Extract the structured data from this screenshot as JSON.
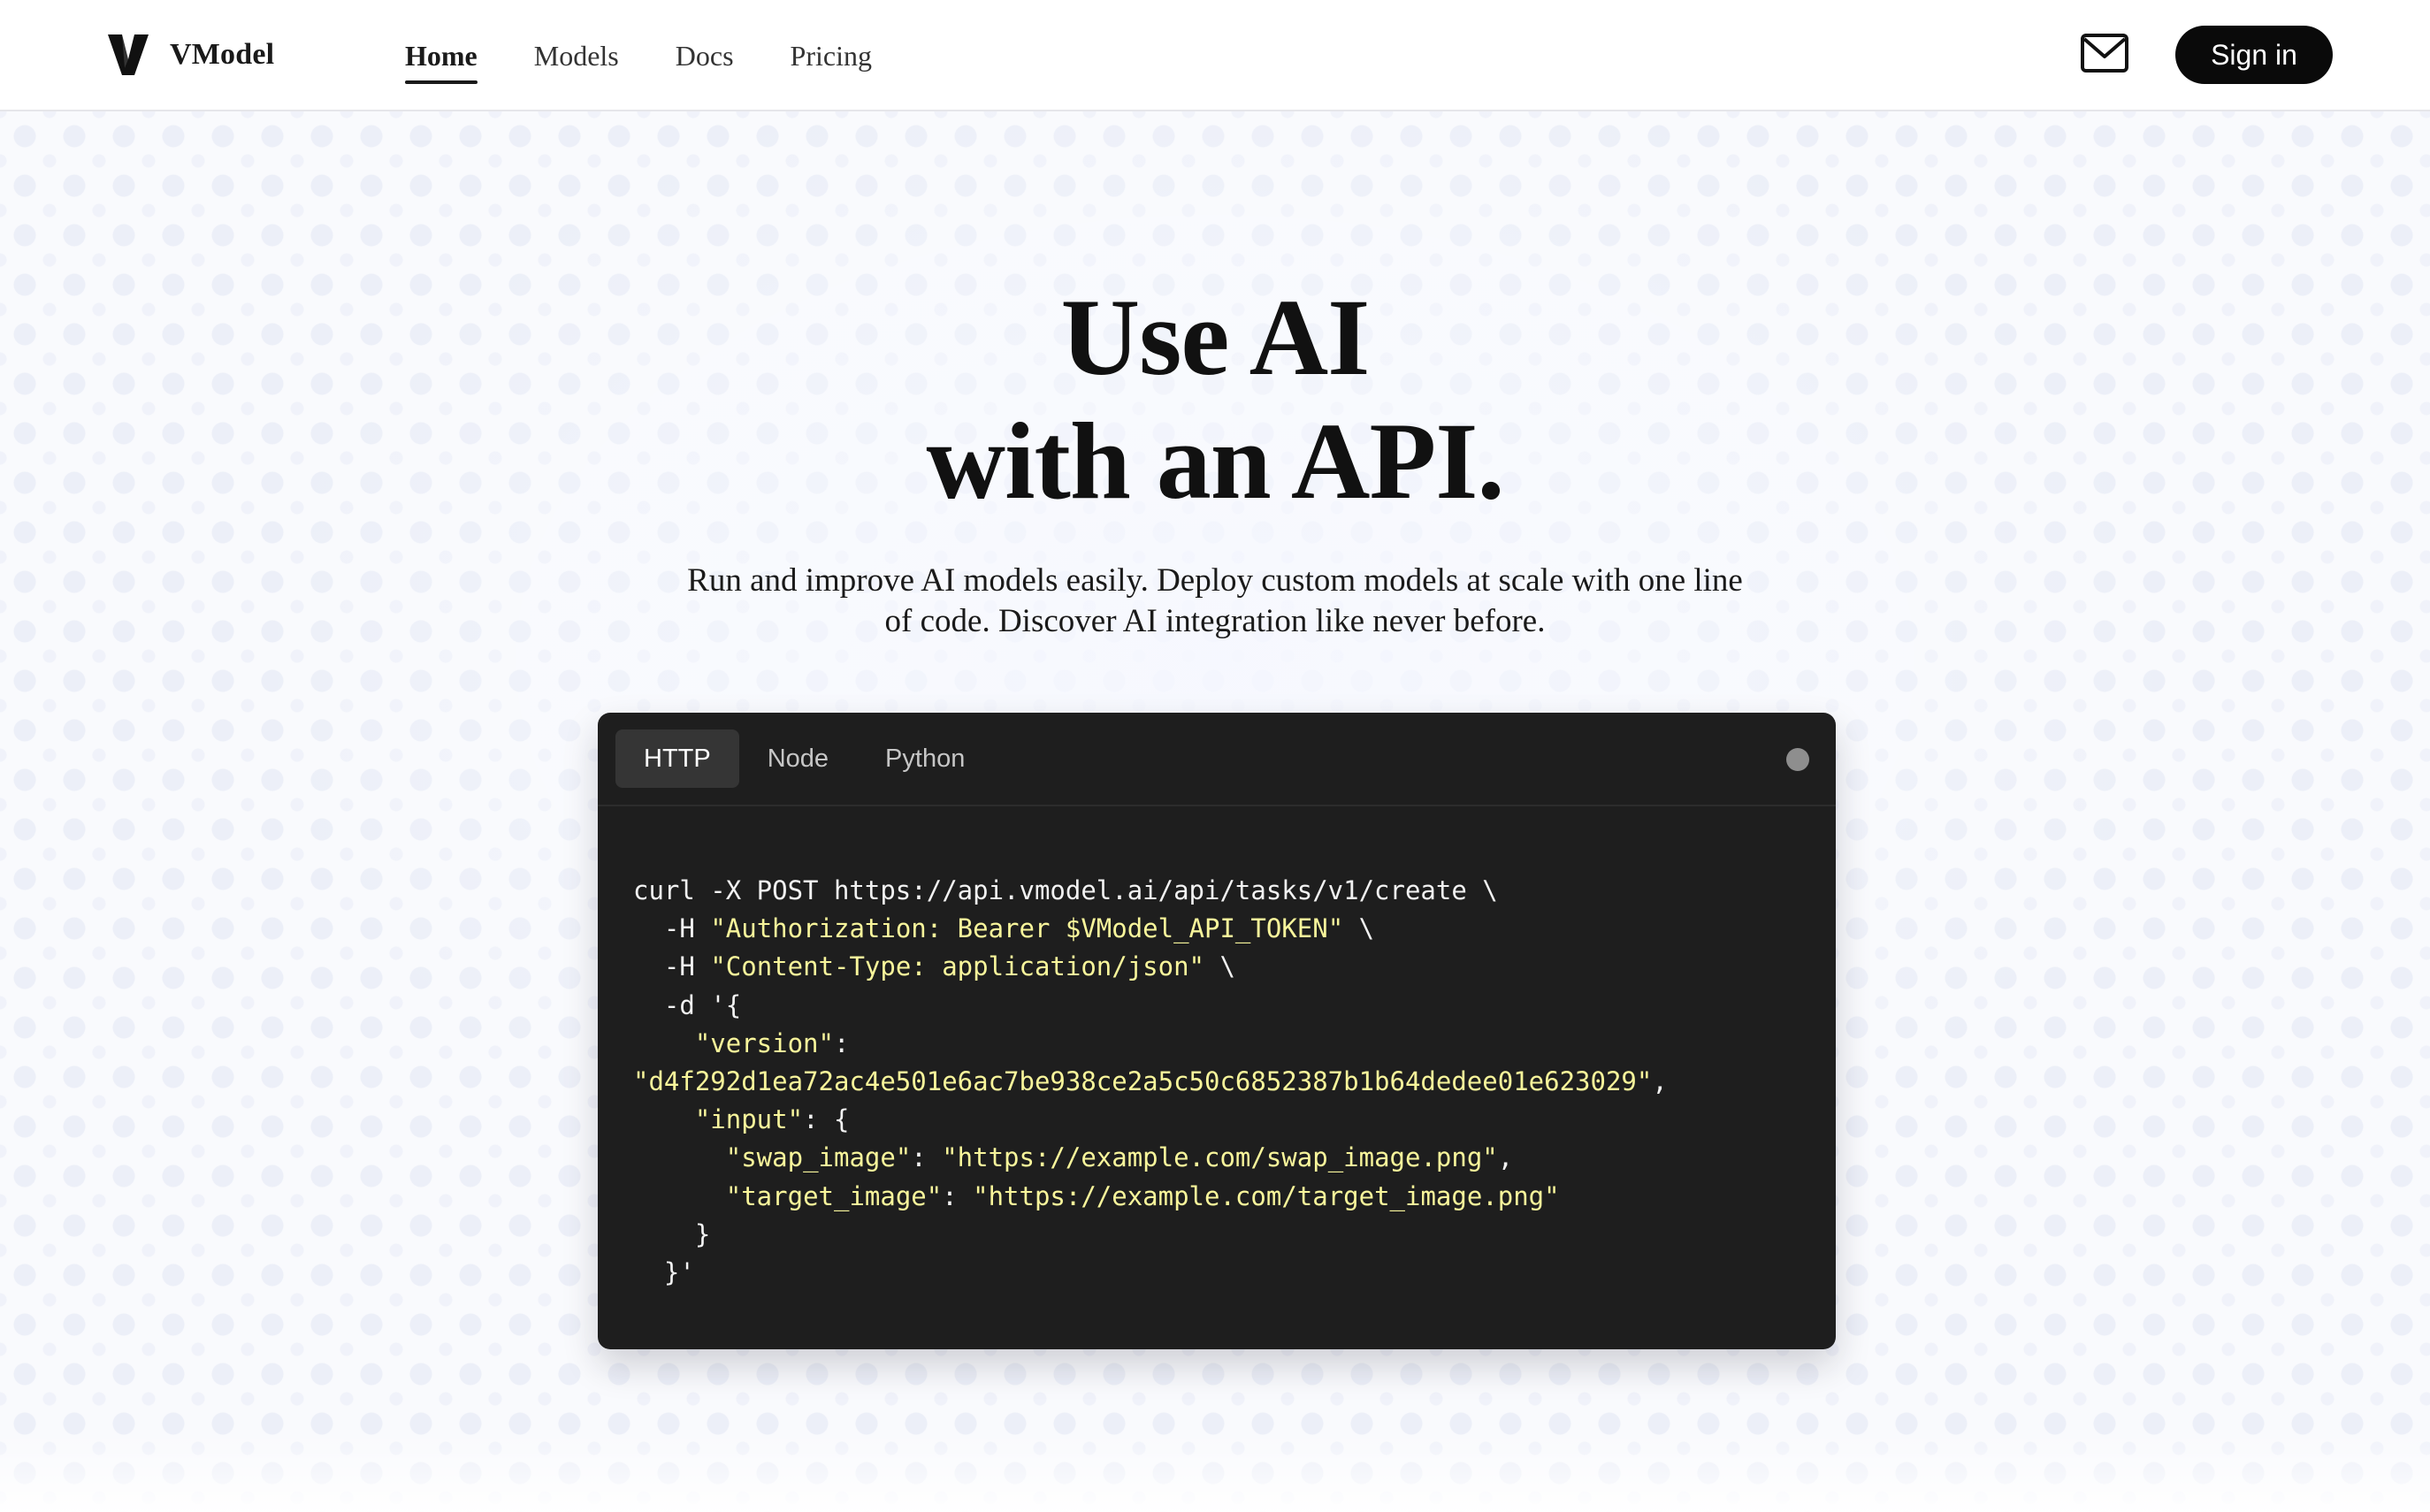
{
  "header": {
    "brand": "VModel",
    "nav": [
      {
        "label": "Home",
        "active": true
      },
      {
        "label": "Models",
        "active": false
      },
      {
        "label": "Docs",
        "active": false
      },
      {
        "label": "Pricing",
        "active": false
      }
    ],
    "mail_icon": "envelope-icon",
    "signin_label": "Sign in"
  },
  "hero": {
    "title_line1": "Use AI",
    "title_line2": "with an API.",
    "subtitle": "Run and improve AI models easily. Deploy custom models at scale with one line of code. Discover AI integration like never before."
  },
  "code": {
    "tabs": [
      {
        "label": "HTTP",
        "active": true
      },
      {
        "label": "Node",
        "active": false
      },
      {
        "label": "Python",
        "active": false
      }
    ],
    "lines": [
      [
        {
          "t": "curl -X POST https://api.vmodel.ai/api/tasks/v1/create \\",
          "c": "plain"
        }
      ],
      [
        {
          "t": "  -H ",
          "c": "plain"
        },
        {
          "t": "\"Authorization: Bearer $VModel_API_TOKEN\"",
          "c": "str"
        },
        {
          "t": " \\",
          "c": "plain"
        }
      ],
      [
        {
          "t": "  -H ",
          "c": "plain"
        },
        {
          "t": "\"Content-Type: application/json\"",
          "c": "str"
        },
        {
          "t": " \\",
          "c": "plain"
        }
      ],
      [
        {
          "t": "  -d '{",
          "c": "plain"
        }
      ],
      [
        {
          "t": "    ",
          "c": "plain"
        },
        {
          "t": "\"version\"",
          "c": "str"
        },
        {
          "t": ":",
          "c": "plain"
        }
      ],
      [
        {
          "t": "\"d4f292d1ea72ac4e501e6ac7be938ce2a5c50c6852387b1b64dedee01e623029\"",
          "c": "str"
        },
        {
          "t": ",",
          "c": "plain"
        }
      ],
      [
        {
          "t": "    ",
          "c": "plain"
        },
        {
          "t": "\"input\"",
          "c": "str"
        },
        {
          "t": ": {",
          "c": "plain"
        }
      ],
      [
        {
          "t": "      ",
          "c": "plain"
        },
        {
          "t": "\"swap_image\"",
          "c": "str"
        },
        {
          "t": ": ",
          "c": "plain"
        },
        {
          "t": "\"https://example.com/swap_image.png\"",
          "c": "str"
        },
        {
          "t": ",",
          "c": "plain"
        }
      ],
      [
        {
          "t": "      ",
          "c": "plain"
        },
        {
          "t": "\"target_image\"",
          "c": "str"
        },
        {
          "t": ": ",
          "c": "plain"
        },
        {
          "t": "\"https://example.com/target_image.png\"",
          "c": "str"
        }
      ],
      [
        {
          "t": "    }",
          "c": "plain"
        }
      ],
      [
        {
          "t": "  }'",
          "c": "plain"
        }
      ]
    ]
  },
  "colors": {
    "brand_dark": "#0a0a0a",
    "code_bg": "#1e1e1e",
    "code_string": "#f8f59b",
    "code_text": "#f2f2f2"
  }
}
